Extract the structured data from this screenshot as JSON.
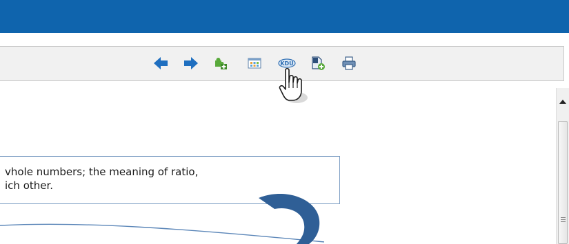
{
  "header": {
    "bar_color": "#0f64ad"
  },
  "toolbar": {
    "buttons": [
      {
        "name": "back-arrow-icon"
      },
      {
        "name": "forward-arrow-icon"
      },
      {
        "name": "add-puzzle-icon"
      },
      {
        "name": "calendar-grid-icon"
      },
      {
        "name": "kdu-icon",
        "label": "KDU"
      },
      {
        "name": "add-document-icon"
      },
      {
        "name": "print-icon"
      }
    ]
  },
  "content": {
    "text_line_1": "vhole numbers; the meaning of ratio,",
    "text_line_2": "ich other."
  },
  "colors": {
    "accent": "#1f6fc0",
    "border": "#7a9cc2"
  }
}
